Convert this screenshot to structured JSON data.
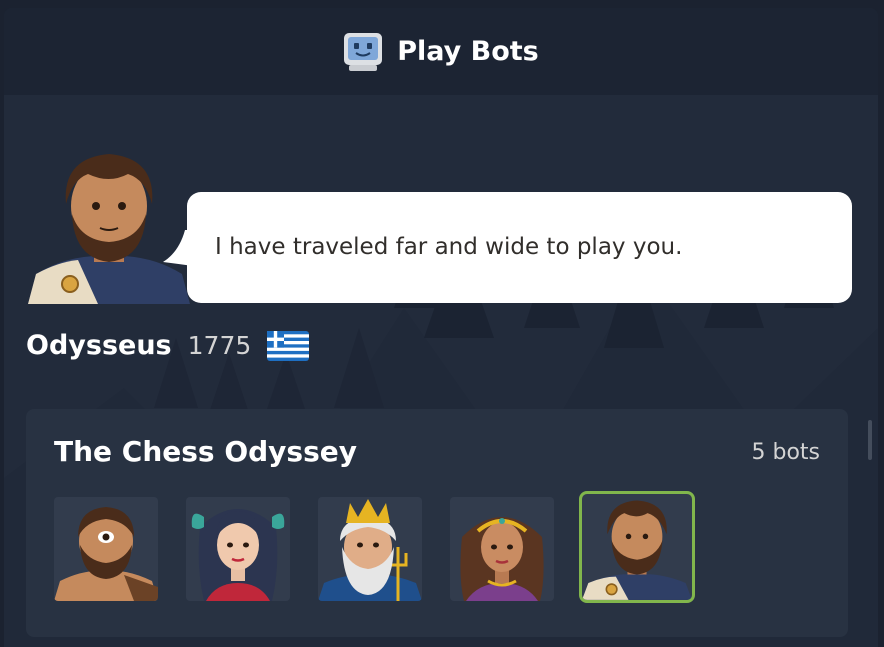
{
  "header": {
    "icon": "robot-monitor-icon",
    "title": "Play Bots"
  },
  "bot": {
    "quote": "I have traveled far and wide to play you.",
    "name": "Odysseus",
    "rating": "1775",
    "flag": "greece-flag-icon"
  },
  "collection": {
    "title": "The Chess Odyssey",
    "count": "5 bots",
    "bots": [
      {
        "avatar": "cyclops-avatar-icon"
      },
      {
        "avatar": "sea-nymph-avatar-icon"
      },
      {
        "avatar": "poseidon-avatar-icon"
      },
      {
        "avatar": "queen-avatar-icon"
      },
      {
        "avatar": "odysseus-avatar-icon",
        "selected": true
      }
    ]
  },
  "colors": {
    "accent": "#81b64c",
    "panel": "#222b3b",
    "header": "#1c2433",
    "card": "#283242"
  }
}
